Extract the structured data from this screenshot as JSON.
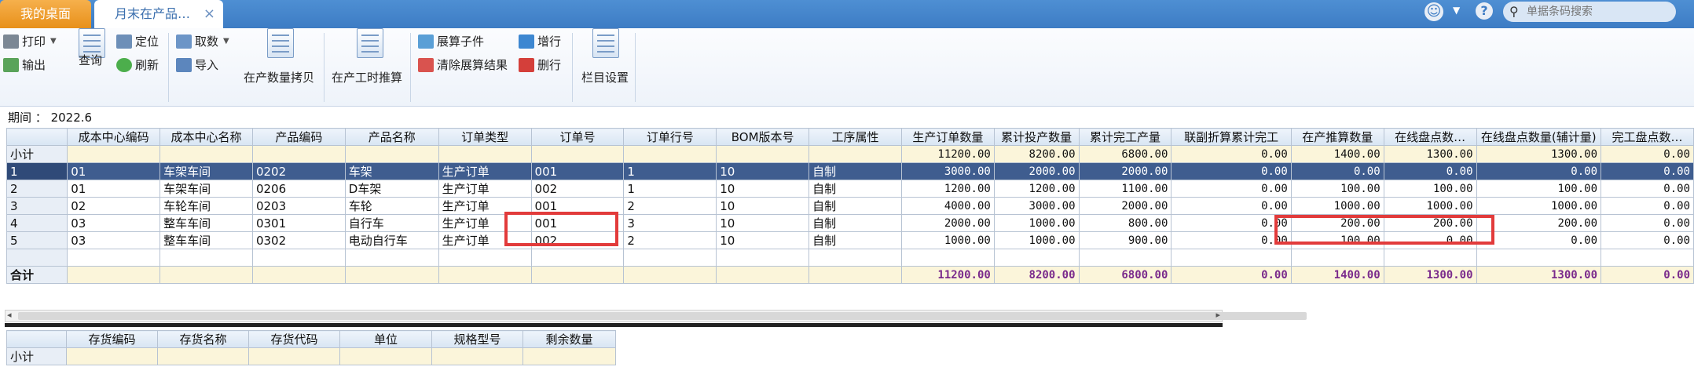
{
  "tabs": {
    "desktop": "我的桌面",
    "active": "月末在产品…",
    "close": "×"
  },
  "header": {
    "search_placeholder": "单据条码搜索",
    "smiley": "☺",
    "caret": "▼",
    "help": "?"
  },
  "toolbar": {
    "print": "打印",
    "export": "输出",
    "query": "查询",
    "locate": "定位",
    "refresh": "刷新",
    "fetch": "取数",
    "import": "导入",
    "copy_qty": "在产数量拷贝",
    "labor_calc": "在产工时推算",
    "expand_sub": "展算子件",
    "clear_expand": "清除展算结果",
    "add_row": "增行",
    "delete_row": "删行",
    "column_settings": "栏目设置"
  },
  "period": {
    "label": "期间",
    "sep": "：",
    "value": "2022.6"
  },
  "main_grid": {
    "headers": [
      "",
      "成本中心编码",
      "成本中心名称",
      "产品编码",
      "产品名称",
      "订单类型",
      "订单号",
      "订单行号",
      "BOM版本号",
      "工序属性",
      "生产订单数量",
      "累计投产数量",
      "累计完工产量",
      "联副折算累计完工",
      "在产推算数量",
      "在线盘点数…",
      "在线盘点数量(辅计量)",
      "完工盘点数…"
    ],
    "subtotal": [
      "小计",
      "",
      "",
      "",
      "",
      "",
      "",
      "",
      "",
      "",
      "11200.00",
      "8200.00",
      "6800.00",
      "0.00",
      "1400.00",
      "1300.00",
      "1300.00",
      "0.00"
    ],
    "rows": [
      [
        "1",
        "01",
        "车架车间",
        "0202",
        "车架",
        "生产订单",
        "001",
        "1",
        "10",
        "自制",
        "3000.00",
        "2000.00",
        "2000.00",
        "0.00",
        "0.00",
        "0.00",
        "0.00",
        "0.00"
      ],
      [
        "2",
        "01",
        "车架车间",
        "0206",
        "D车架",
        "生产订单",
        "002",
        "1",
        "10",
        "自制",
        "1200.00",
        "1200.00",
        "1100.00",
        "0.00",
        "100.00",
        "100.00",
        "100.00",
        "0.00"
      ],
      [
        "3",
        "02",
        "车轮车间",
        "0203",
        "车轮",
        "生产订单",
        "001",
        "2",
        "10",
        "自制",
        "4000.00",
        "3000.00",
        "2000.00",
        "0.00",
        "1000.00",
        "1000.00",
        "1000.00",
        "0.00"
      ],
      [
        "4",
        "03",
        "整车车间",
        "0301",
        "自行车",
        "生产订单",
        "001",
        "3",
        "10",
        "自制",
        "2000.00",
        "1000.00",
        "800.00",
        "0.00",
        "200.00",
        "200.00",
        "200.00",
        "0.00"
      ],
      [
        "5",
        "03",
        "整车车间",
        "0302",
        "电动自行车",
        "生产订单",
        "002",
        "2",
        "10",
        "自制",
        "1000.00",
        "1000.00",
        "900.00",
        "0.00",
        "100.00",
        "0.00",
        "0.00",
        "0.00"
      ]
    ],
    "total": [
      "合计",
      "",
      "",
      "",
      "",
      "",
      "",
      "",
      "",
      "",
      "11200.00",
      "8200.00",
      "6800.00",
      "0.00",
      "1400.00",
      "1300.00",
      "1300.00",
      "0.00"
    ]
  },
  "sub_grid": {
    "headers": [
      "",
      "存货编码",
      "存货名称",
      "存货代码",
      "单位",
      "规格型号",
      "剩余数量"
    ],
    "subtotal": [
      "小计",
      "",
      "",
      "",
      "",
      "",
      ""
    ]
  },
  "scroll": {
    "left_arrow": "◂",
    "right_arrow": "▸"
  }
}
